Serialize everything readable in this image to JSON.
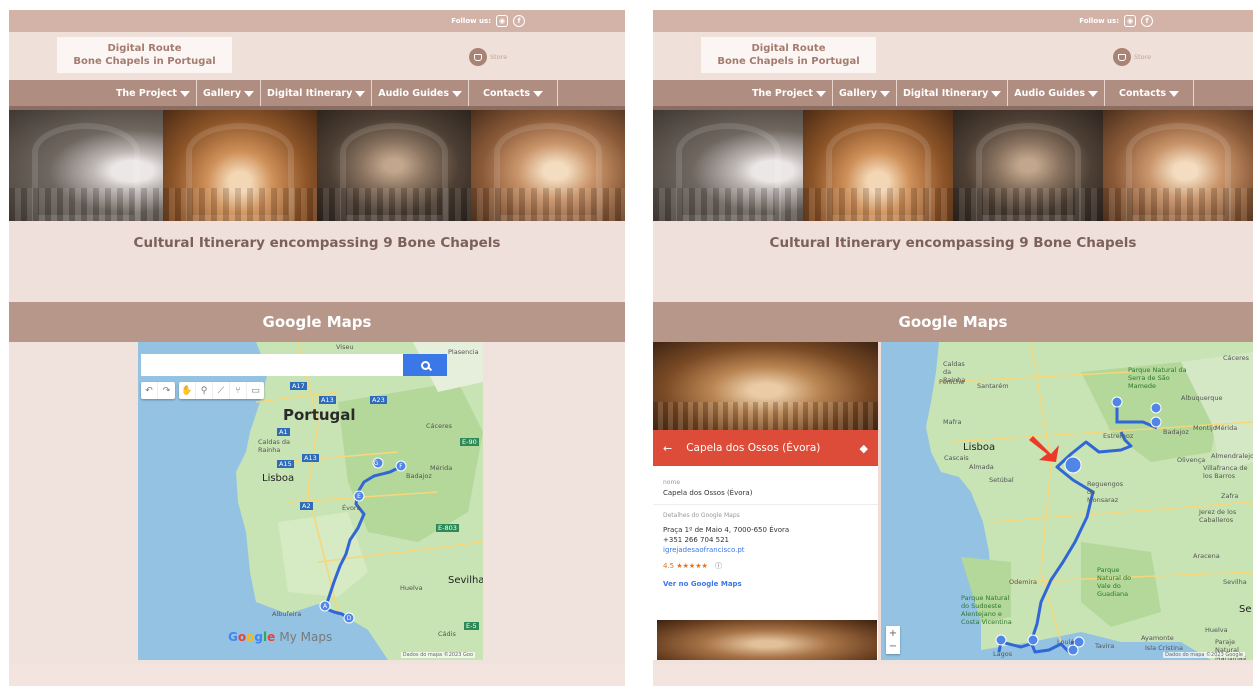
{
  "header": {
    "follow_label": "Follow us:",
    "logo_line1": "Digital Route",
    "logo_line2": "Bone Chapels in Portugal",
    "store_label": "Store"
  },
  "nav": [
    {
      "label": "The Project"
    },
    {
      "label": "Gallery"
    },
    {
      "label": "Digital Itinerary"
    },
    {
      "label": "Audio Guides"
    },
    {
      "label": "Contacts"
    }
  ],
  "tagline": "Cultural Itinerary encompassing 9 Bone Chapels",
  "maps_heading": "Google Maps",
  "left_map": {
    "search_value": "",
    "logo_text": "My Maps",
    "labels": [
      "Viseu",
      "Plasencia",
      "Portugal",
      "Cáceres",
      "Caldas da Rainha",
      "Lisboa",
      "Mérida",
      "Badajoz",
      "Évora",
      "Huelva",
      "Sevilha",
      "Albufeira",
      "Cádis"
    ],
    "road_labels": [
      "A17",
      "A13",
      "A23",
      "A1",
      "A13",
      "A15",
      "E-90",
      "A2",
      "E-803",
      "E-5"
    ],
    "footer": "Dados do mapa ©2023 Goo"
  },
  "right_map": {
    "place_name": "Capela dos Ossos (Évora)",
    "name_label": "nome",
    "name_value": "Capela dos Ossos (Évora)",
    "details_label": "Detalhes do Google Maps",
    "address": "Praça 1º de Maio 4, 7000-650 Évora",
    "phone": "+351 266 704 521",
    "website": "igrejadesaofrancisco.pt",
    "rating": "4.5",
    "stars": "★★★★★",
    "see_link": "Ver no Google Maps",
    "labels": [
      "Cáceres",
      "Caldas da Rainha",
      "Parque Natural da Serra de São Mamede",
      "Albuquerque",
      "Santarém",
      "Peniche",
      "Mafra",
      "Estremoz",
      "Badajoz",
      "Mérida",
      "Montijo",
      "Lisboa",
      "Cascais",
      "Almada",
      "Setúbal",
      "Olivença",
      "Almendralejo",
      "Villafranca de los Barros",
      "Reguengos de Monsaraz",
      "Zafra",
      "Jerez de los Caballeros",
      "Aracena",
      "Parque Natural do Vale do Guadiana",
      "Odemira",
      "Parque Natural do Sudoeste Alentejano e Costa Vicentina",
      "Ayamonte",
      "Huelva",
      "Tavira",
      "Lagos",
      "Loulé",
      "Isla Cristina",
      "Paraje Natural Marismas",
      "Sevilha",
      "Se"
    ],
    "footer": "Dados do mapa ©2023 Google"
  },
  "colors": {
    "accent": "#b8978b",
    "route": "#3166d6",
    "pin": "#4f86e8",
    "red_header": "#dd4b39",
    "arrow": "#ec3a2a"
  }
}
